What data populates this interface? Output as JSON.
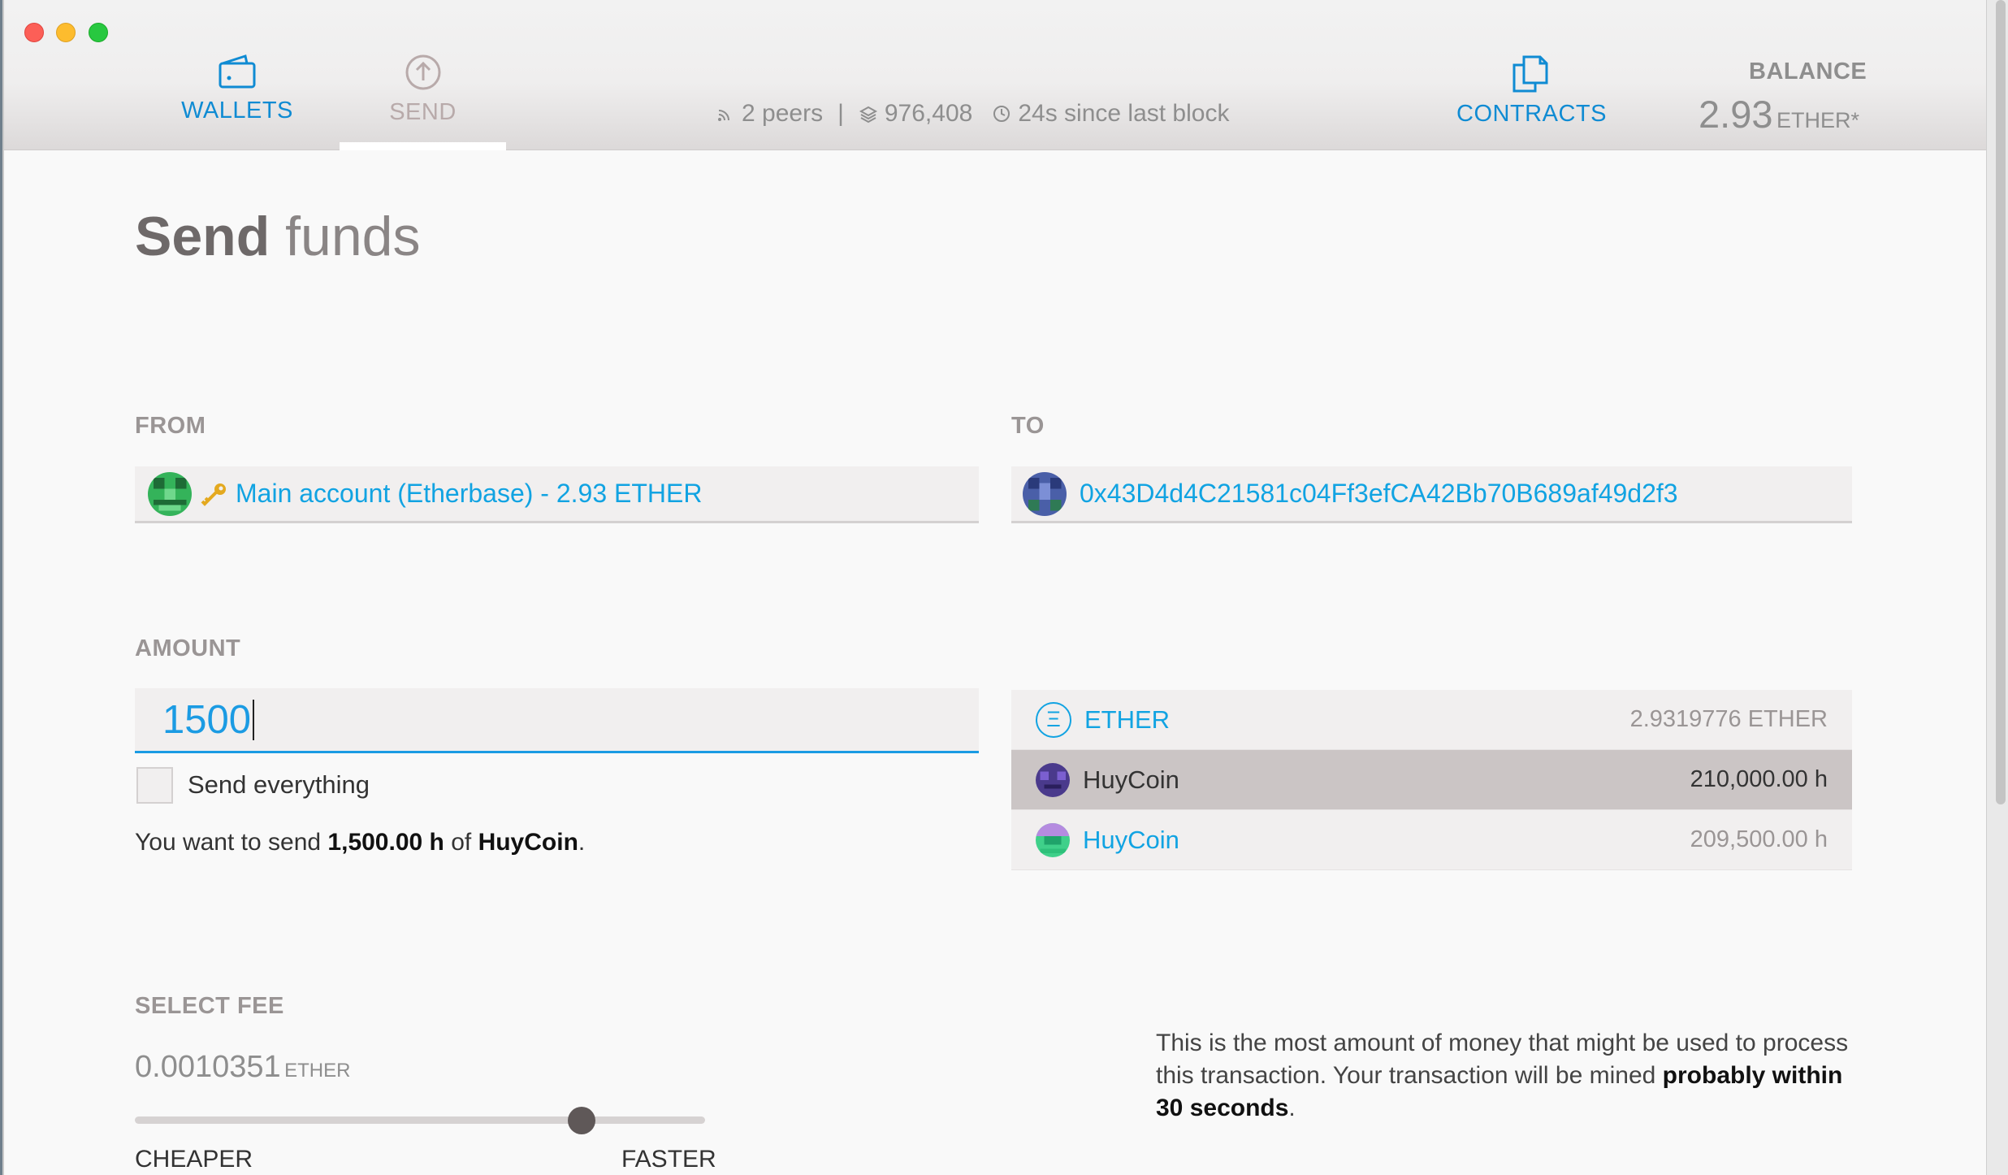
{
  "nav": {
    "wallets_label": "WALLETS",
    "send_label": "SEND",
    "contracts_label": "CONTRACTS"
  },
  "status": {
    "peers": "2 peers",
    "block": "976,408",
    "since_block": "24s since last block"
  },
  "balance": {
    "label": "BALANCE",
    "value": "2.93",
    "unit": "ETHER*"
  },
  "page": {
    "title_bold": "Send",
    "title_light": " funds"
  },
  "from": {
    "label": "FROM",
    "account": "Main account (Etherbase) - 2.93 ETHER"
  },
  "to": {
    "label": "TO",
    "address": "0x43D4d4C21581c04Ff3efCA42Bb70B689af49d2f3"
  },
  "amount": {
    "label": "AMOUNT",
    "value": "1500",
    "send_everything_label": "Send everything",
    "summary_prefix": "You want to send ",
    "summary_amount": "1,500.00 h",
    "summary_mid": " of ",
    "summary_token": "HuyCoin",
    "summary_suffix": "."
  },
  "tokens": [
    {
      "name": "ETHER",
      "balance": "2.9319776 ETHER",
      "icon": "ether-icon",
      "selected": false
    },
    {
      "name": "HuyCoin",
      "balance": "210,000.00 h",
      "icon": "huycoin-purple-icon",
      "selected": true
    },
    {
      "name": "HuyCoin",
      "balance": "209,500.00 h",
      "icon": "huycoin-green-icon",
      "selected": false
    }
  ],
  "fee": {
    "label": "SELECT FEE",
    "value": "0.0010351",
    "unit": "ETHER",
    "min_label": "CHEAPER",
    "max_label": "FASTER",
    "slider_level": 0.79,
    "note_text": "This is the most amount of money that might be used to process this transaction. Your transaction will be mined ",
    "note_bold": "probably within 30 seconds",
    "note_end": "."
  },
  "colors": {
    "accent": "#11a3e2",
    "nav_active": "#0f8bd3",
    "selected_row": "#cbc5c5"
  }
}
